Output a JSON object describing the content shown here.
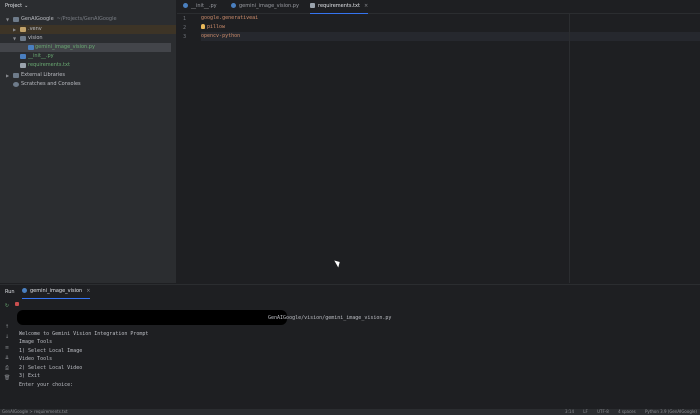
{
  "project_panel": {
    "title": "Project",
    "tree": [
      {
        "label": "GenAIGoogle",
        "path": "~/Projects/GenAIGoogle"
      },
      {
        "label": ".venv"
      },
      {
        "label": "vision"
      },
      {
        "label": "gemini_image_vision.py"
      },
      {
        "label": "__init__.py"
      },
      {
        "label": "requirements.txt"
      },
      {
        "label": "External Libraries"
      },
      {
        "label": "Scratches and Consoles"
      }
    ]
  },
  "editor": {
    "tabs": [
      {
        "label": "__init__.py"
      },
      {
        "label": "gemini_image_vision.py"
      },
      {
        "label": "requirements.txt",
        "active": true
      }
    ],
    "line_numbers": [
      "1",
      "2",
      "3"
    ],
    "lines": [
      "google.generativeai",
      "pillow",
      "opencv-python"
    ]
  },
  "run_panel": {
    "label": "Run",
    "tab_label": "gemini_image_vision",
    "command_tail": "GenAIGoogle/vision/gemini_image_vision.py",
    "output": [
      "Welcome to Gemini Vision Integration Prompt",
      "Image Tools",
      "1) Select Local Image",
      "Video Tools",
      "2) Select Local Video",
      "3) Exit",
      "Enter your choice:"
    ]
  },
  "status_bar": {
    "breadcrumb": "GenAIGoogle  >  requirements.txt",
    "position": "3:14",
    "line_sep": "LF",
    "encoding": "UTF-8",
    "indent": "4 spaces",
    "interpreter": "Python 3.9 (GenAIGoogle)"
  },
  "colors": {
    "accent": "#3574f0",
    "background": "#1e1f22",
    "panel": "#2b2d30"
  }
}
